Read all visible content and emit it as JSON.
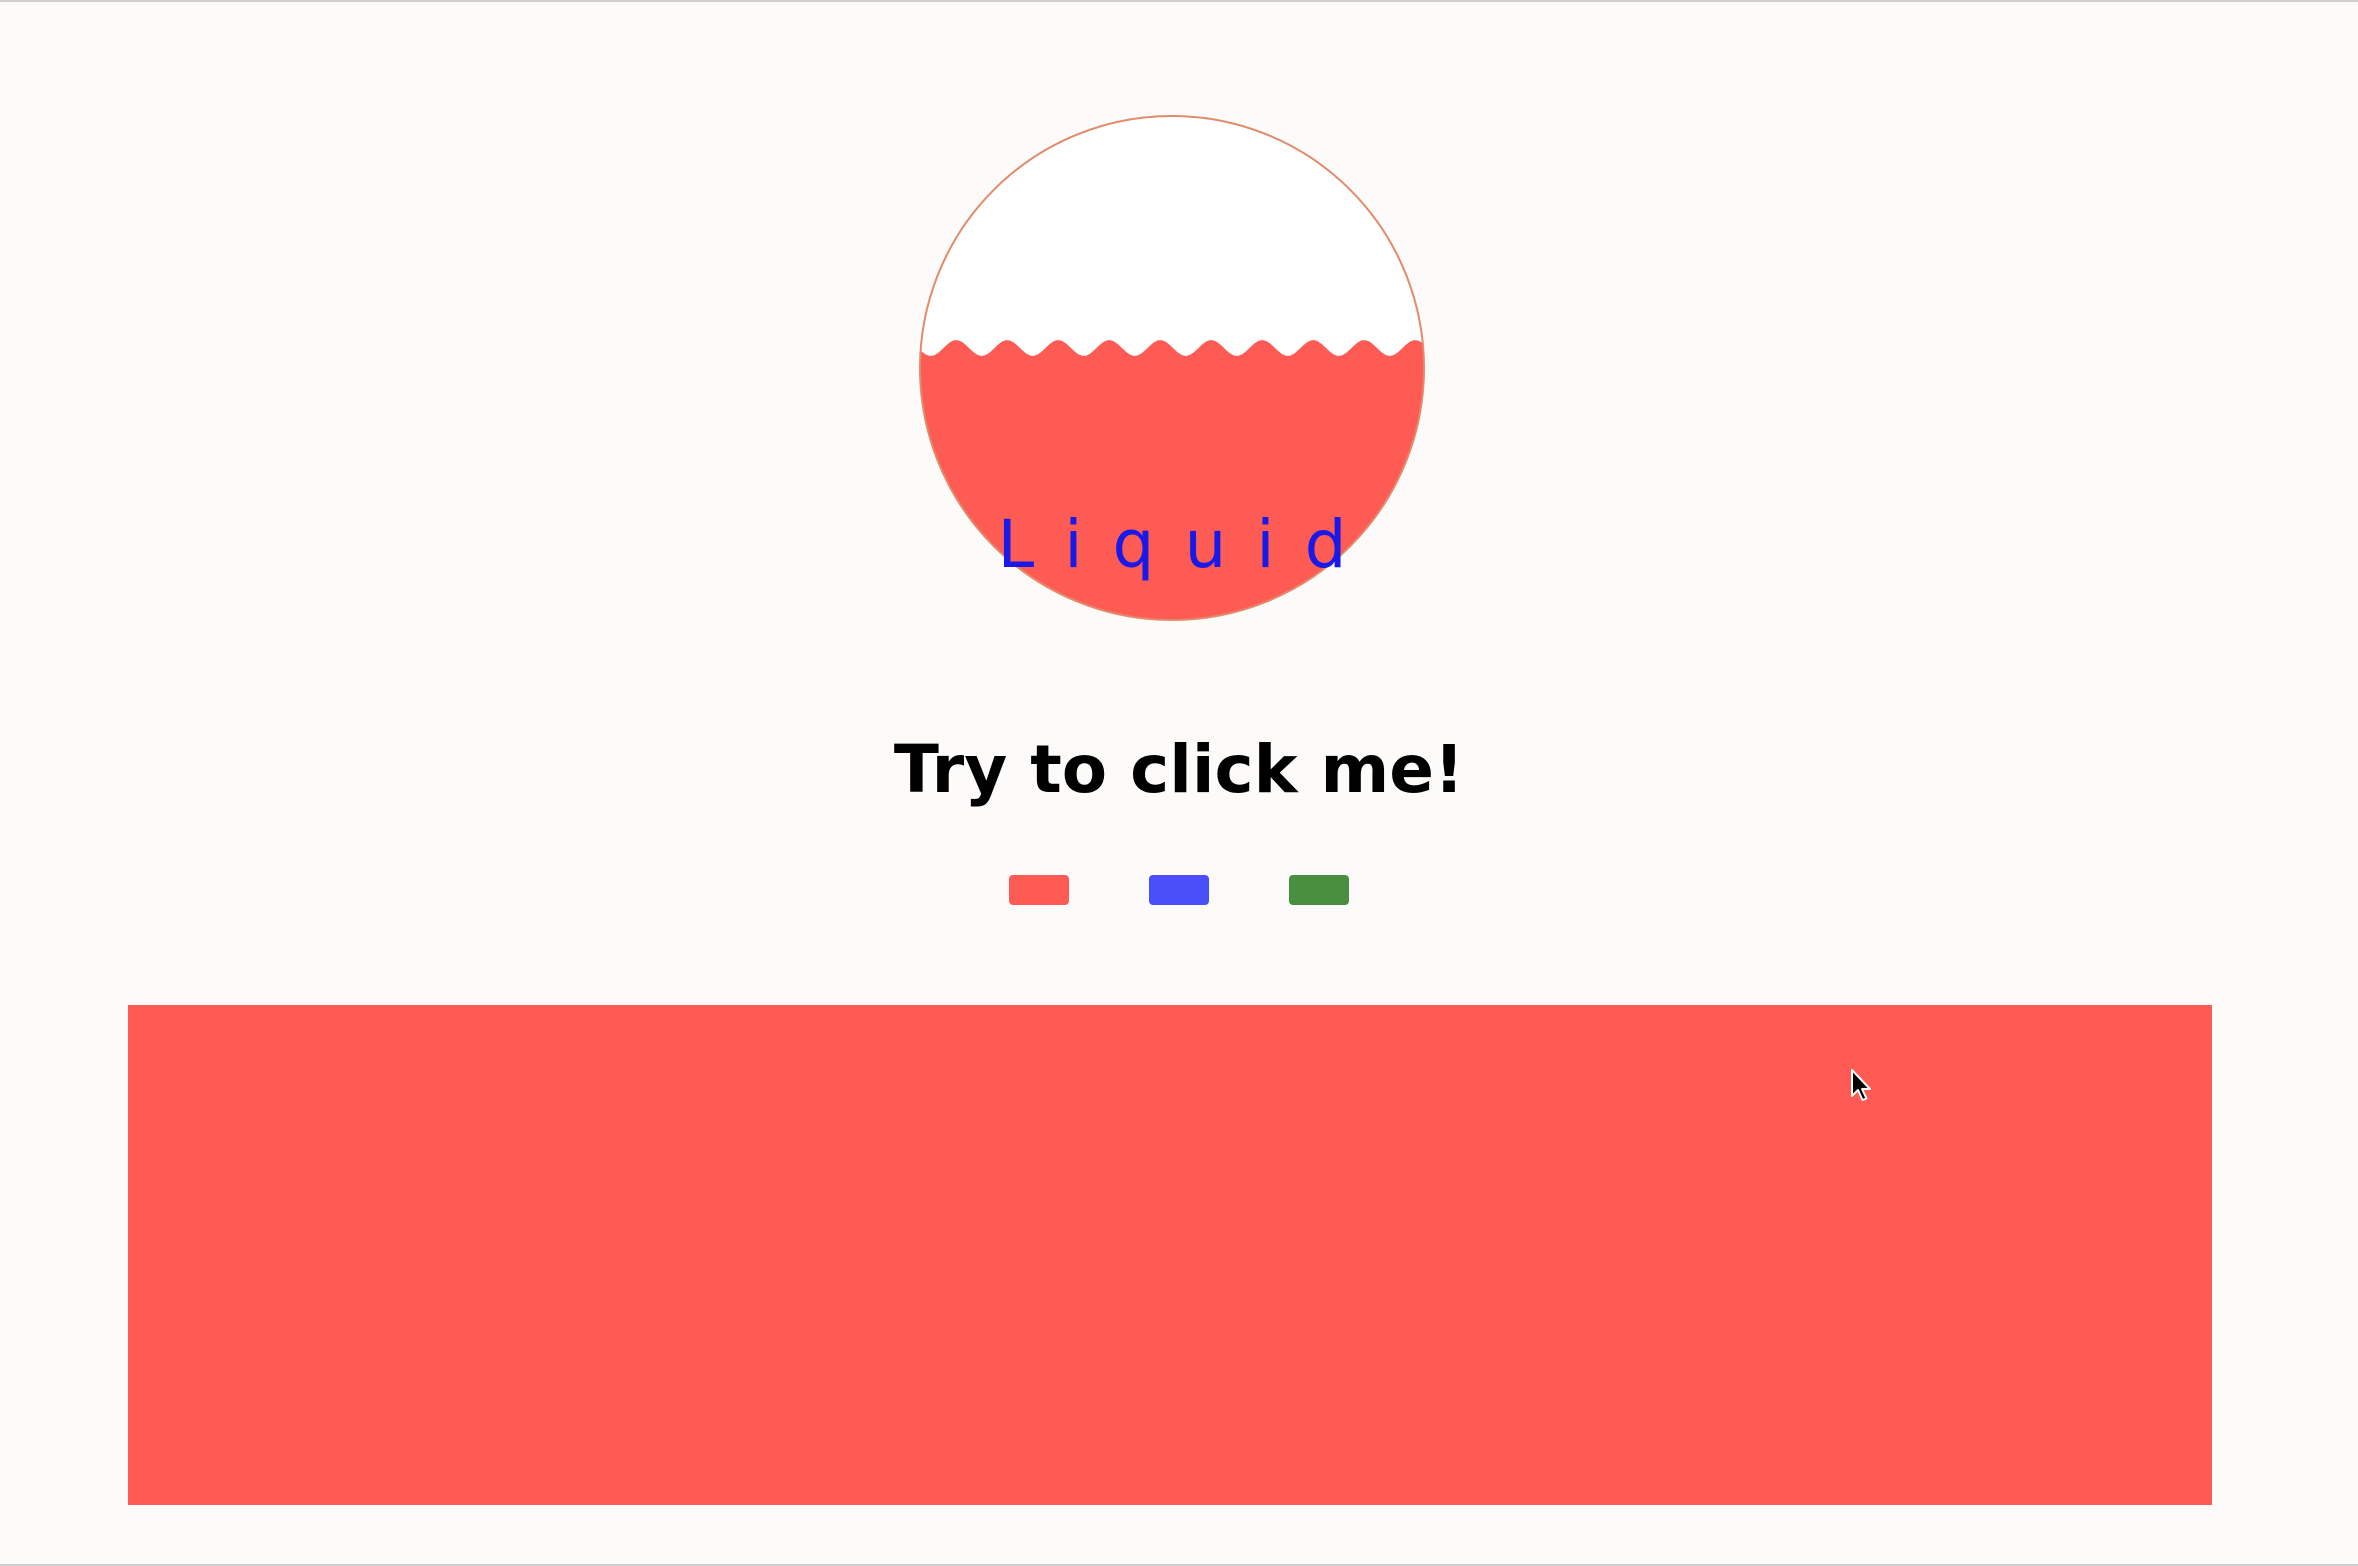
{
  "liquid": {
    "label": "Liquid",
    "fill_level_percent": 50,
    "liquid_color": "#fd5b54",
    "label_color": "#1a1ae8",
    "outline_color": "#e38a6a"
  },
  "headline": {
    "text": "Try to click me!"
  },
  "swatches": [
    {
      "name": "red",
      "color": "#fd5b54"
    },
    {
      "name": "blue",
      "color": "#4b4ffa"
    },
    {
      "name": "green",
      "color": "#4a8f3f"
    }
  ],
  "panel": {
    "color": "#fd5b54"
  },
  "icons": {
    "cursor": "mouse-pointer-icon"
  }
}
